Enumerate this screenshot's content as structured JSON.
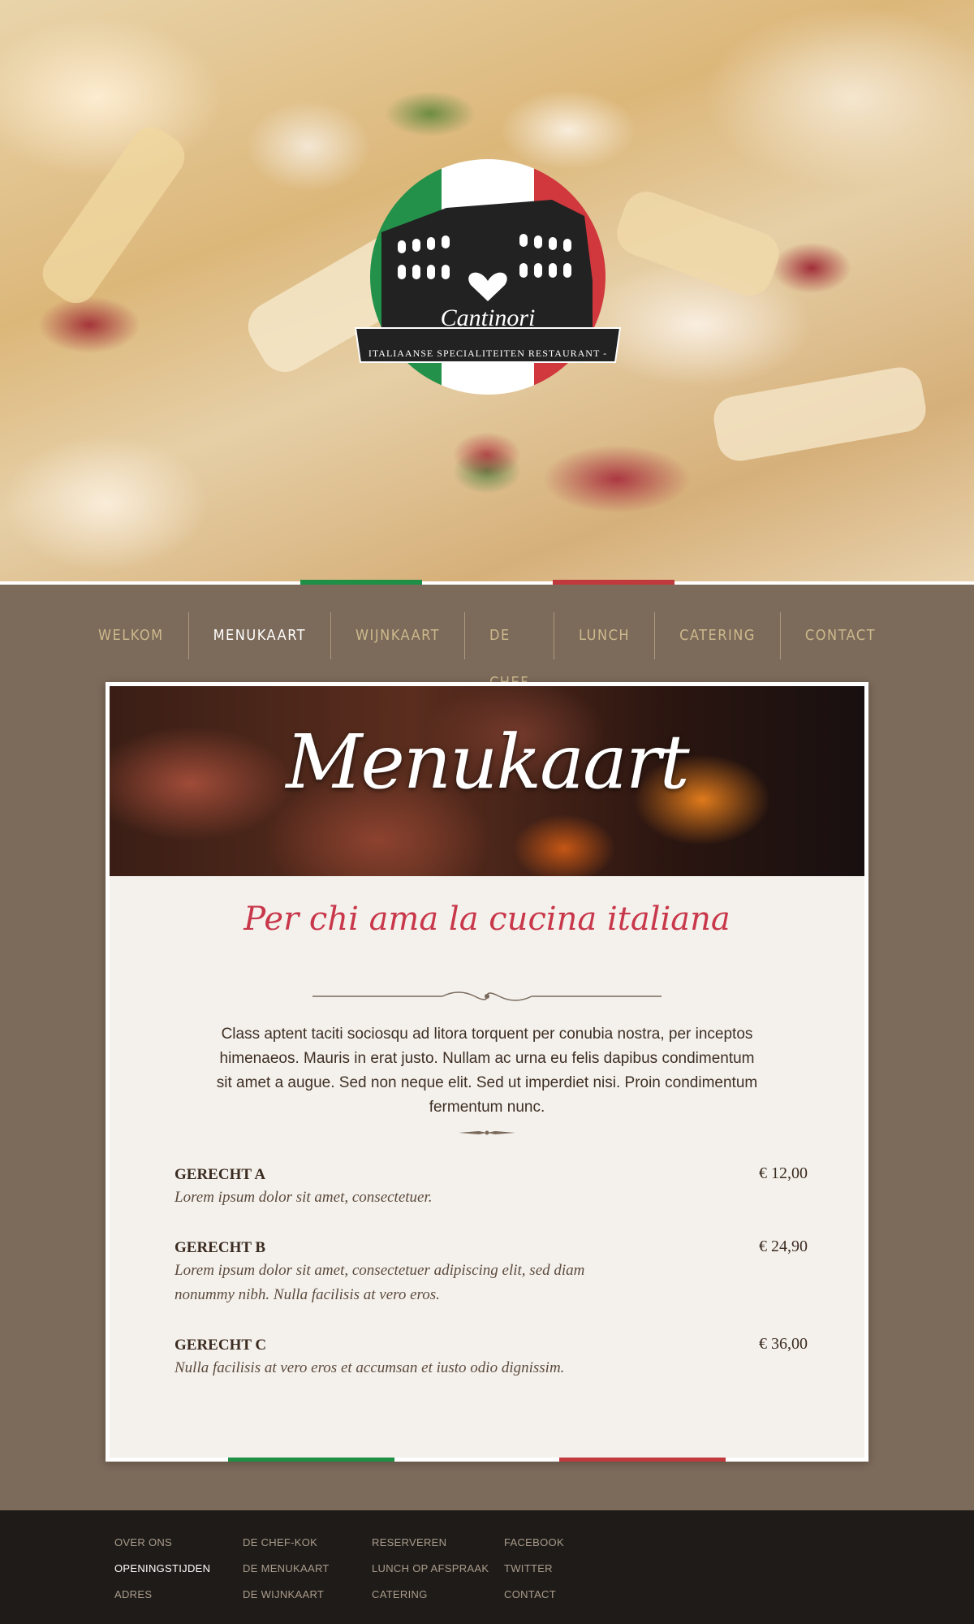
{
  "brand": {
    "logo_text": "Il Cantinori",
    "tagline": "ITALIAANSE SPECIALITEITEN RESTAURANT - PIZZERIA"
  },
  "nav": {
    "items": [
      {
        "label": "WELKOM",
        "active": false
      },
      {
        "label": "MENUKAART",
        "active": true
      },
      {
        "label": "WIJNKAART",
        "active": false
      },
      {
        "label": "DE CHEF",
        "active": false
      },
      {
        "label": "LUNCH",
        "active": false
      },
      {
        "label": "CATERING",
        "active": false
      },
      {
        "label": "CONTACT",
        "active": false
      }
    ]
  },
  "page": {
    "banner_title": "Menukaart",
    "subtitle": "Per chi ama la cucina italiana",
    "intro": "Class aptent taciti sociosqu ad litora torquent per conubia nostra, per inceptos himenaeos. Mauris in erat justo. Nullam ac urna eu felis dapibus condimentum sit amet a augue. Sed non neque elit. Sed ut imperdiet nisi. Proin condimentum fermentum nunc."
  },
  "dishes": [
    {
      "name": "GERECHT A",
      "description": "Lorem ipsum dolor sit amet, consectetuer.",
      "price": "€ 12,00"
    },
    {
      "name": "GERECHT B",
      "description": "Lorem ipsum dolor sit amet, consectetuer adipiscing elit, sed diam nonummy nibh. Nulla facilisis at vero eros.",
      "price": "€ 24,90"
    },
    {
      "name": "GERECHT C",
      "description": "Nulla facilisis at vero eros et accumsan et iusto odio dignissim.",
      "price": "€ 36,00"
    }
  ],
  "footer": {
    "columns": [
      [
        "OVER ONS",
        "OPENINGSTIJDEN",
        "ADRES"
      ],
      [
        "DE CHEF-KOK",
        "DE MENUKAART",
        "DE WIJNKAART"
      ],
      [
        "RESERVEREN",
        "LUNCH OP AFSPRAAK",
        "CATERING"
      ],
      [
        "FACEBOOK",
        "TWITTER",
        "CONTACT"
      ]
    ],
    "active_item": "OPENINGSTIJDEN"
  },
  "colors": {
    "italian_green": "#1f8f45",
    "italian_red": "#c0393c",
    "accent_text": "#c8374a",
    "nav_text": "#cdb98c",
    "background": "#7c6a5a",
    "footer_bg": "#1f1b18"
  }
}
